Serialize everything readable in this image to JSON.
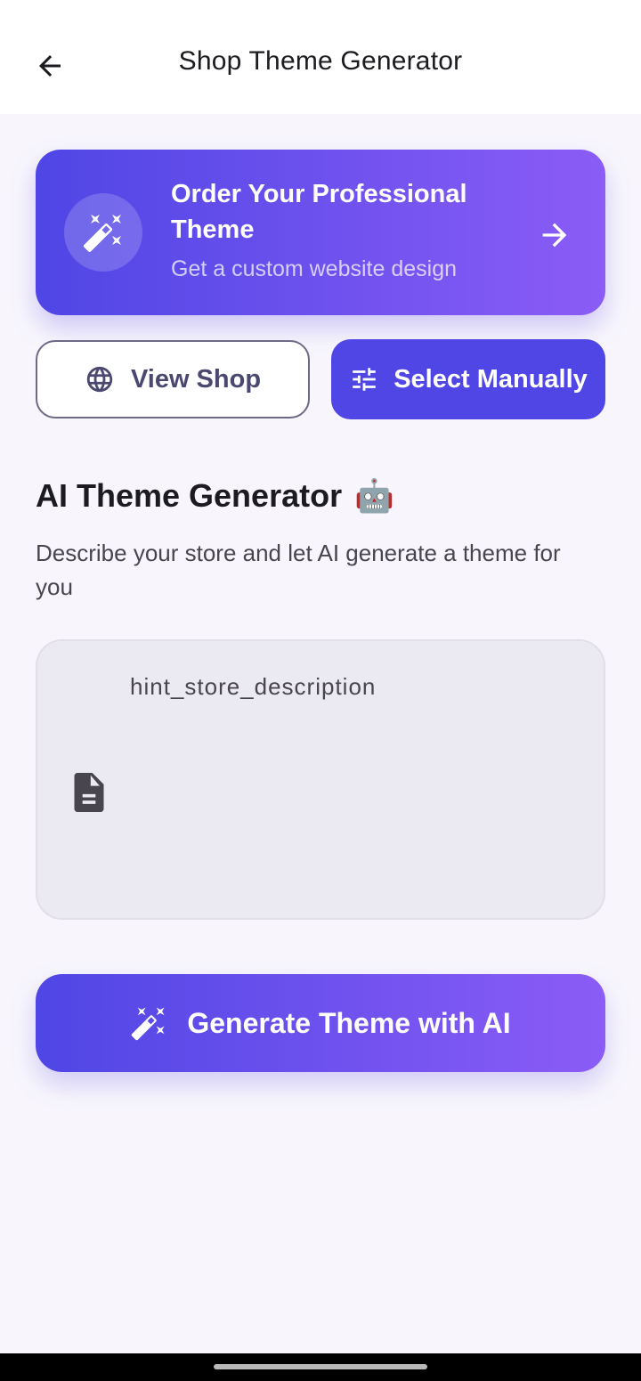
{
  "appbar": {
    "title": "Shop Theme Generator",
    "back_icon": "arrow-left-icon"
  },
  "promo": {
    "title": "Order Your Professional Theme",
    "subtitle": "Get a custom website design",
    "icon": "magic-wand-icon",
    "arrow_icon": "arrow-right-icon"
  },
  "actions": {
    "view_shop_label": "View Shop",
    "view_shop_icon": "globe-icon",
    "select_manually_label": "Select Manually",
    "select_manually_icon": "tune-icon"
  },
  "ai_section": {
    "title": "AI Theme Generator",
    "emoji": "🤖",
    "description": "Describe your store and let AI generate a theme for you",
    "field_placeholder": "hint_store_description",
    "field_value": "",
    "field_icon": "document-icon"
  },
  "generate": {
    "label": "Generate Theme with AI",
    "icon": "magic-wand-icon"
  },
  "colors": {
    "primary": "#4f46e5",
    "gradient_end": "#8b5cf6",
    "background": "#f8f6fc",
    "field_bg": "#ebe9f1"
  }
}
